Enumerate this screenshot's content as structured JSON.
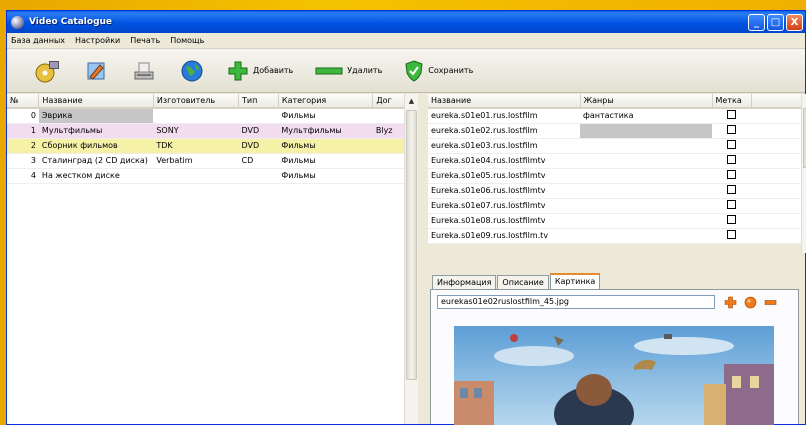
{
  "window": {
    "title": "Video Catalogue",
    "min": "_",
    "max": "□",
    "close": "X"
  },
  "menu": [
    "База данных",
    "Настройки",
    "Печать",
    "Помощь"
  ],
  "toolbar": {
    "add": "Добавить",
    "delete": "Удалить",
    "save": "Сохранить"
  },
  "left_table": {
    "headers": [
      "№",
      "Название",
      "Изготовитель",
      "Тип",
      "Категория",
      "Дог"
    ],
    "rows": [
      [
        "0",
        "Эврика",
        "",
        "",
        "Фильмы",
        ""
      ],
      [
        "1",
        "Мультфильмы",
        "SONY",
        "DVD",
        "Мультфильмы",
        "Blyz"
      ],
      [
        "2",
        "Сборник фильмов",
        "TDK",
        "DVD",
        "Фильмы",
        ""
      ],
      [
        "3",
        "Сталинград (2 CD диска)",
        "Verbatim",
        "CD",
        "Фильмы",
        ""
      ],
      [
        "4",
        "На жестком диске",
        "",
        "",
        "Фильмы",
        ""
      ]
    ]
  },
  "right_table": {
    "headers": [
      "Название",
      "Жанры",
      "Метка"
    ],
    "rows": [
      [
        "eureka.s01e01.rus.lostfilm",
        "фантастика"
      ],
      [
        "eureka.s01e02.rus.lostfilm",
        ""
      ],
      [
        "eureka.s01e03.rus.lostfilm",
        ""
      ],
      [
        "Eureka.s01e04.rus.lostfilmtv",
        ""
      ],
      [
        "Eureka.s01e05.rus.lostfilmtv",
        ""
      ],
      [
        "Eureka.s01e06.rus.lostfilmtv",
        ""
      ],
      [
        "Eureka.s01e07.rus.lostfilmtv",
        ""
      ],
      [
        "Eureka.s01e08.rus.lostfilmtv",
        ""
      ],
      [
        "Eureka.s01e09.rus.lostfilm.tv",
        ""
      ]
    ]
  },
  "tabs": [
    "Информация",
    "Описание",
    "Картинка"
  ],
  "picture": {
    "filename": "eurekas01e02ruslostfilm_45.jpg"
  },
  "colors": {
    "title_bar": "#0054e3",
    "row_pink": "#f2dcef",
    "row_yellow": "#f5f2a8",
    "accent_orange": "#f07a1a"
  }
}
